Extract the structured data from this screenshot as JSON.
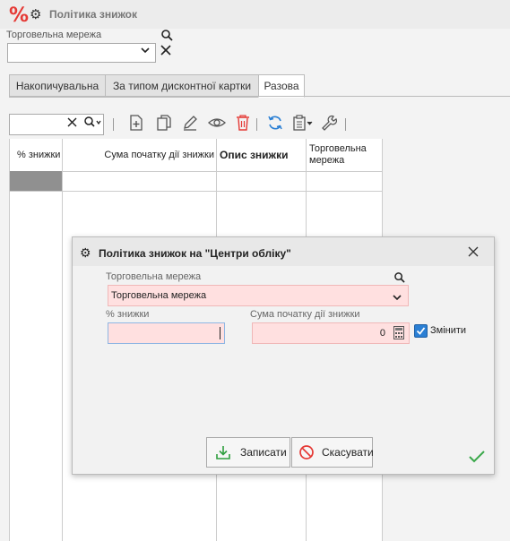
{
  "window": {
    "title": "Політика знижок",
    "app_icon": "percent-icon",
    "gear_icon": "gear-icon"
  },
  "filter": {
    "label": "Торговельна мережа",
    "value": ""
  },
  "tabs": [
    {
      "label": "Накопичувальна"
    },
    {
      "label": "За типом дисконтної картки"
    },
    {
      "label": "Разова",
      "active": true
    }
  ],
  "grid": {
    "columns": [
      {
        "label": "% знижки"
      },
      {
        "label": "Сума початку дії знижки"
      },
      {
        "label": "Опис знижки"
      },
      {
        "label": "Торговельна мережа"
      }
    ]
  },
  "dialog": {
    "title": "Політика знижок на \"Центри обліку\"",
    "network_label": "Торговельна мережа",
    "network_value": "Торговельна мережа",
    "percent_label": "% знижки",
    "percent_value": "",
    "amount_label": "Сума початку дії знижки",
    "amount_value": "0",
    "change_label": "Змінити",
    "change_checked": true,
    "save_label": "Записати",
    "cancel_label": "Скасувати"
  },
  "colors": {
    "accent": "#e53935",
    "required_field": "#ffe0e0",
    "selected_row": "#909090"
  }
}
